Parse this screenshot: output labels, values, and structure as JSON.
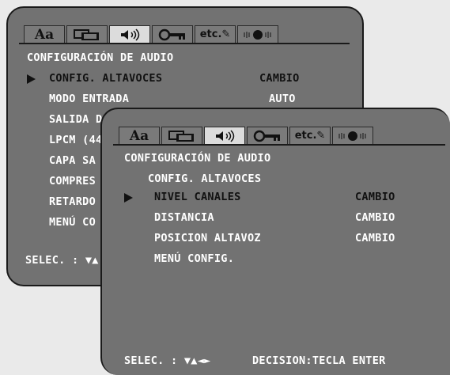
{
  "colors": {
    "panel": "#727272",
    "active_tab": "#dcdcdc",
    "text": "#ffffff",
    "border": "#1a1a1a"
  },
  "tabs": [
    {
      "icon": "language-icon",
      "label": "Aa"
    },
    {
      "icon": "display-icon",
      "label": ""
    },
    {
      "icon": "speaker-icon",
      "label": ""
    },
    {
      "icon": "key-icon",
      "label": ""
    },
    {
      "icon": "etc-tools-icon",
      "label": "etc."
    },
    {
      "icon": "playback-icon",
      "label": ""
    }
  ],
  "back": {
    "title": "CONFIGURACIÓN DE AUDIO",
    "items": [
      {
        "label": "CONFIG. ALTAVOCES",
        "value": "CAMBIO",
        "selected": true
      },
      {
        "label": "MODO ENTRADA",
        "value": "AUTO"
      },
      {
        "label": "SALIDA D"
      },
      {
        "label": "LPCM (44"
      },
      {
        "label": "CAPA SA"
      },
      {
        "label": "COMPRES"
      },
      {
        "label": "RETARDO"
      },
      {
        "label": "MENÚ CO"
      }
    ],
    "footer": "SELEC. : ▼▲"
  },
  "front": {
    "title": "CONFIGURACIÓN DE AUDIO",
    "subtitle": "CONFIG. ALTAVOCES",
    "items": [
      {
        "label": "NIVEL CANALES",
        "value": "CAMBIO",
        "selected": true
      },
      {
        "label": "DISTANCIA",
        "value": "CAMBIO"
      },
      {
        "label": "POSICION ALTAVOZ",
        "value": "CAMBIO"
      },
      {
        "label": "MENÚ CONFIG.",
        "value": ""
      }
    ],
    "footer_select": "SELEC. : ▼▲◄►",
    "footer_decision": "DECISION:TECLA ENTER"
  }
}
